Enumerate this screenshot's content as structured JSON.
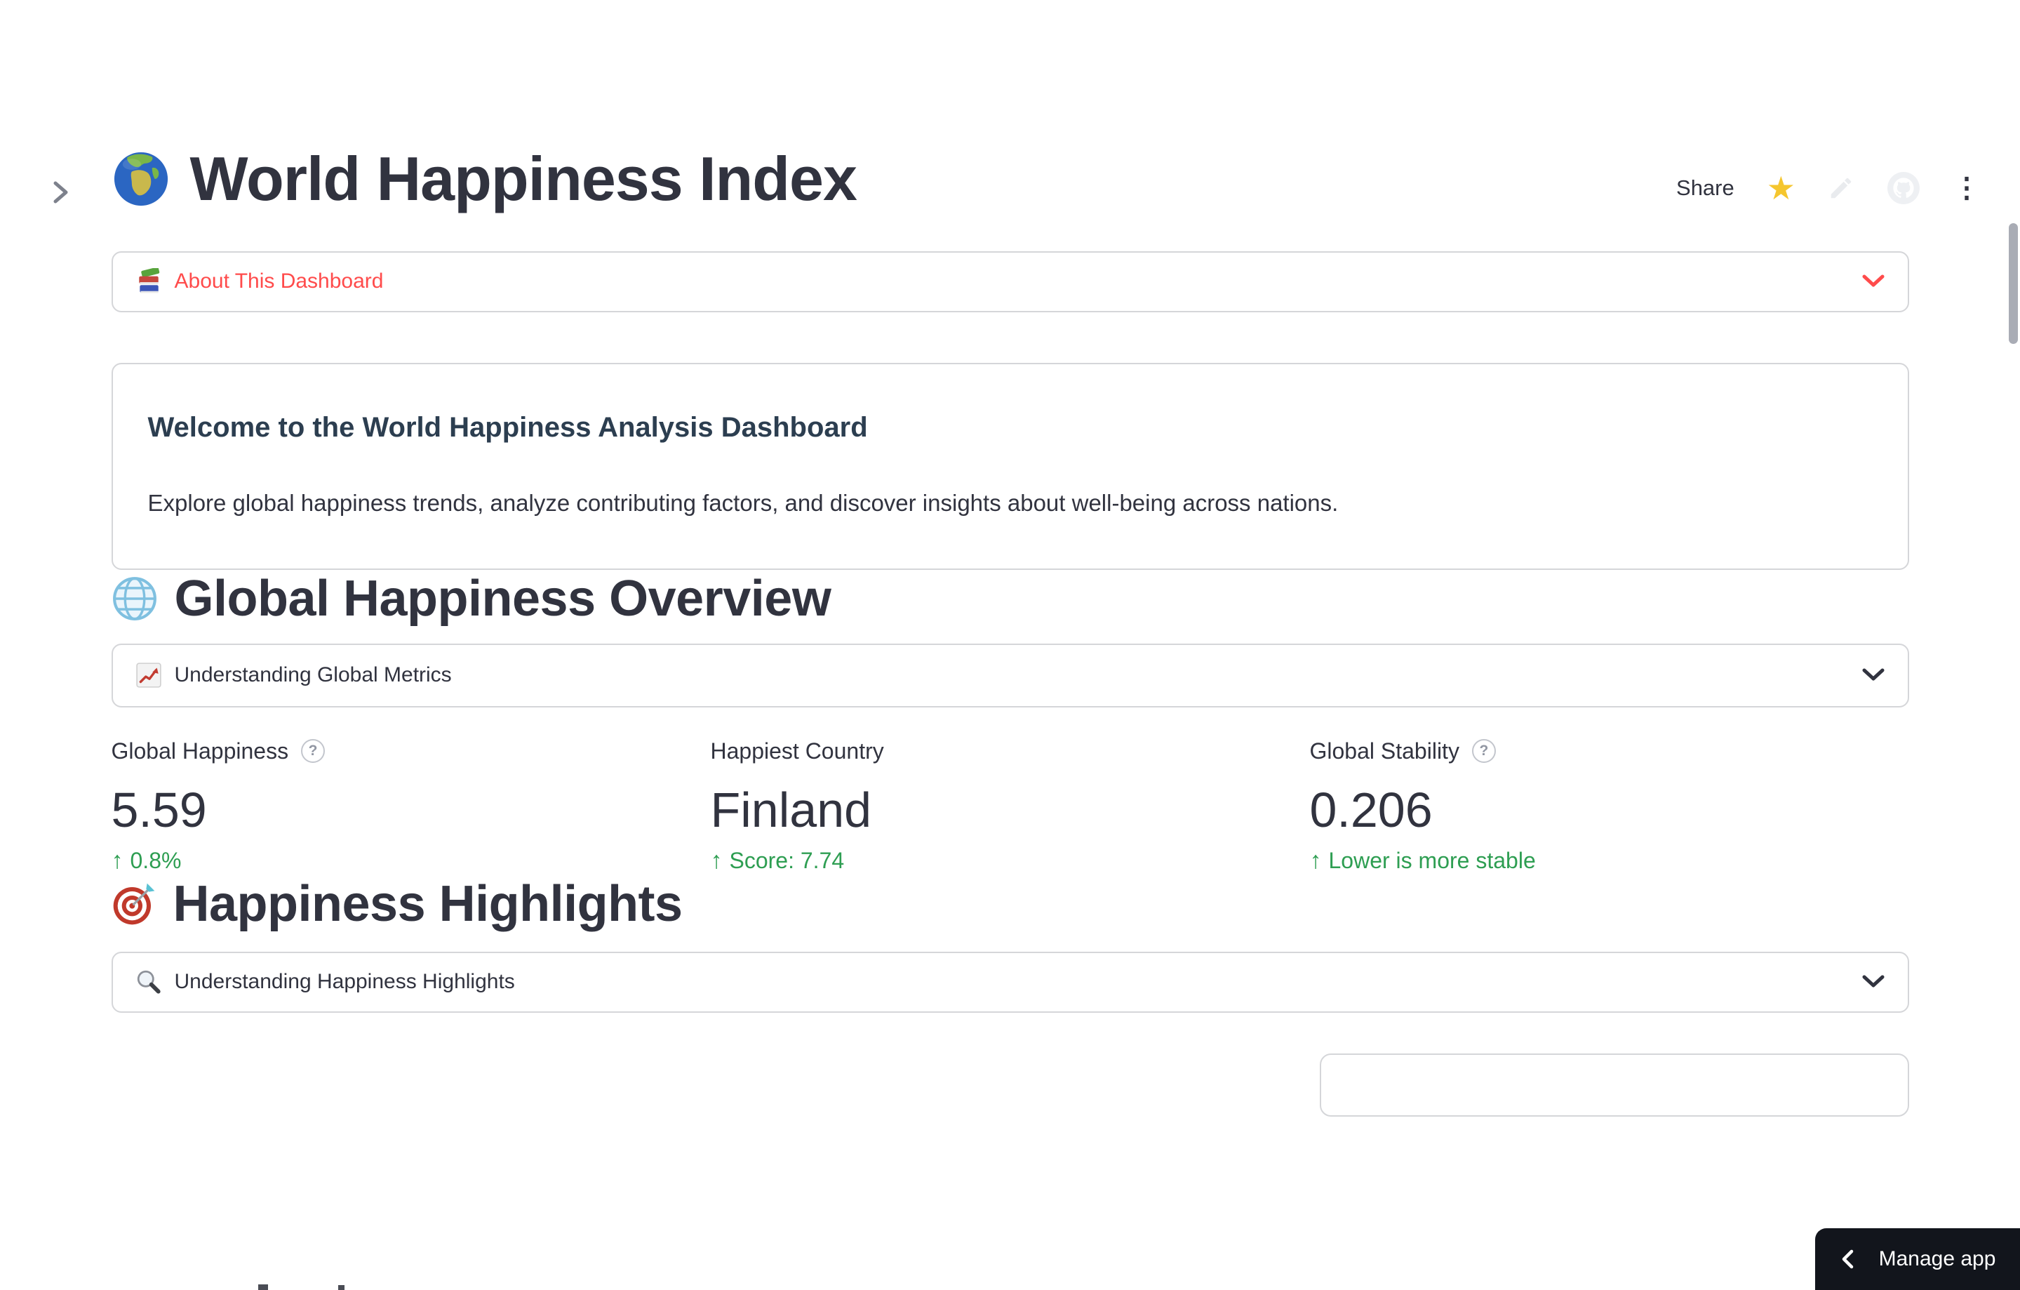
{
  "toolbar": {
    "share_label": "Share"
  },
  "page": {
    "title": "World Happiness Index"
  },
  "about_expander": {
    "label": "About This Dashboard"
  },
  "welcome": {
    "heading": "Welcome to the World Happiness Analysis Dashboard",
    "body": "Explore global happiness trends, analyze contributing factors, and discover insights about well-being across nations."
  },
  "overview_section": {
    "title": "Global Happiness Overview",
    "expander_label": "Understanding Global Metrics"
  },
  "metrics": [
    {
      "label": "Global Happiness",
      "value": "5.59",
      "delta": "0.8%"
    },
    {
      "label": "Happiest Country",
      "value": "Finland",
      "delta": "Score: 7.74"
    },
    {
      "label": "Global Stability",
      "value": "0.206",
      "delta": "Lower is more stable"
    }
  ],
  "highlights_section": {
    "title": "Happiness Highlights",
    "expander_label": "Understanding Happiness Highlights"
  },
  "manage_app": {
    "label": "Manage app"
  },
  "icons": {
    "title_icon": "globe-showing-europe-africa",
    "about_icon": "books",
    "overview_icon": "globe-with-meridians",
    "overview_expander_icon": "chart-increasing",
    "highlights_icon": "direct-hit-target",
    "highlights_expander_icon": "magnifying-glass",
    "arrow_up": "↑",
    "help_glyph": "?",
    "kebab_glyph": "⋮",
    "star_glyph": "★"
  },
  "colors": {
    "accent_red": "#FF4B4B",
    "delta_green": "#2E9E52",
    "text_dark": "#31333F",
    "star_gold": "#F5C62E",
    "border": "#D5D6D9"
  }
}
